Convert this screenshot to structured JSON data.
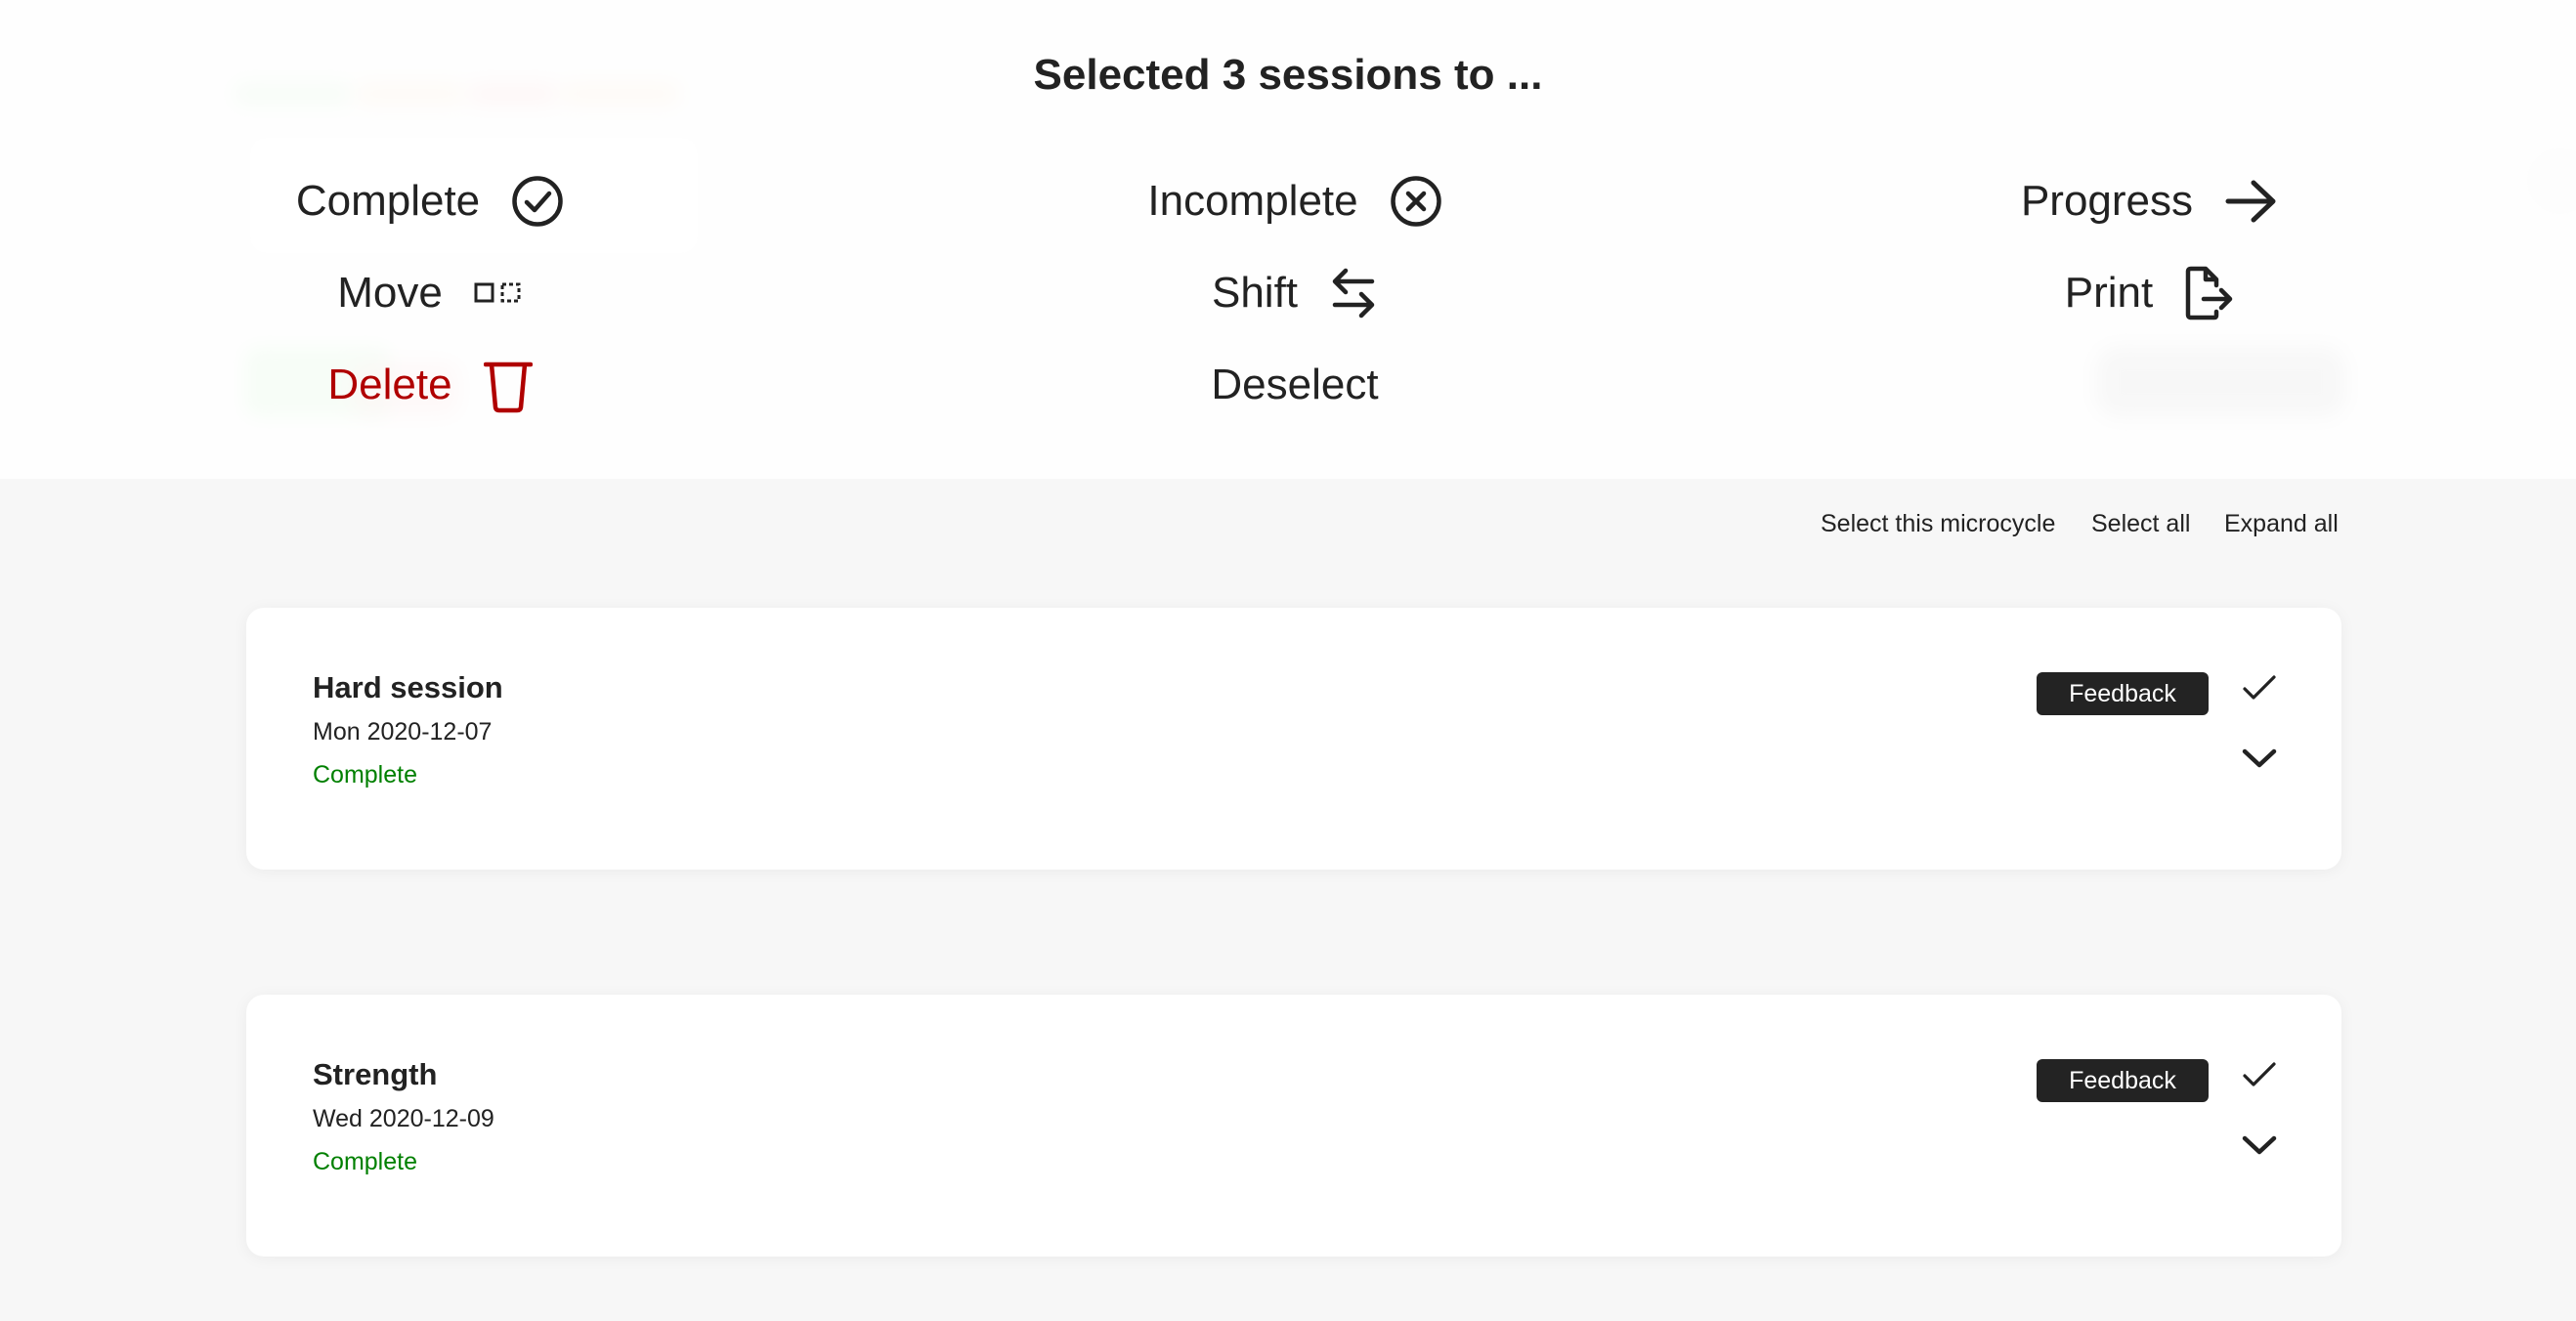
{
  "overlay": {
    "title": "Selected 3 sessions to ...",
    "actions": {
      "complete": "Complete",
      "incomplete": "Incomplete",
      "progress": "Progress",
      "move": "Move",
      "shift": "Shift",
      "print": "Print",
      "delete": "Delete",
      "deselect": "Deselect"
    }
  },
  "toolbar": {
    "select_microcycle": "Select this microcycle",
    "select_all": "Select all",
    "expand_all": "Expand all"
  },
  "sessions": [
    {
      "title": "Hard session",
      "date": "Mon 2020-12-07",
      "status": "Complete",
      "feedback_label": "Feedback"
    },
    {
      "title": "Strength",
      "date": "Wed 2020-12-09",
      "status": "Complete",
      "feedback_label": "Feedback"
    }
  ],
  "colors": {
    "status_complete": "#008000",
    "delete": "#b00000",
    "feedback_bg": "#232323"
  }
}
